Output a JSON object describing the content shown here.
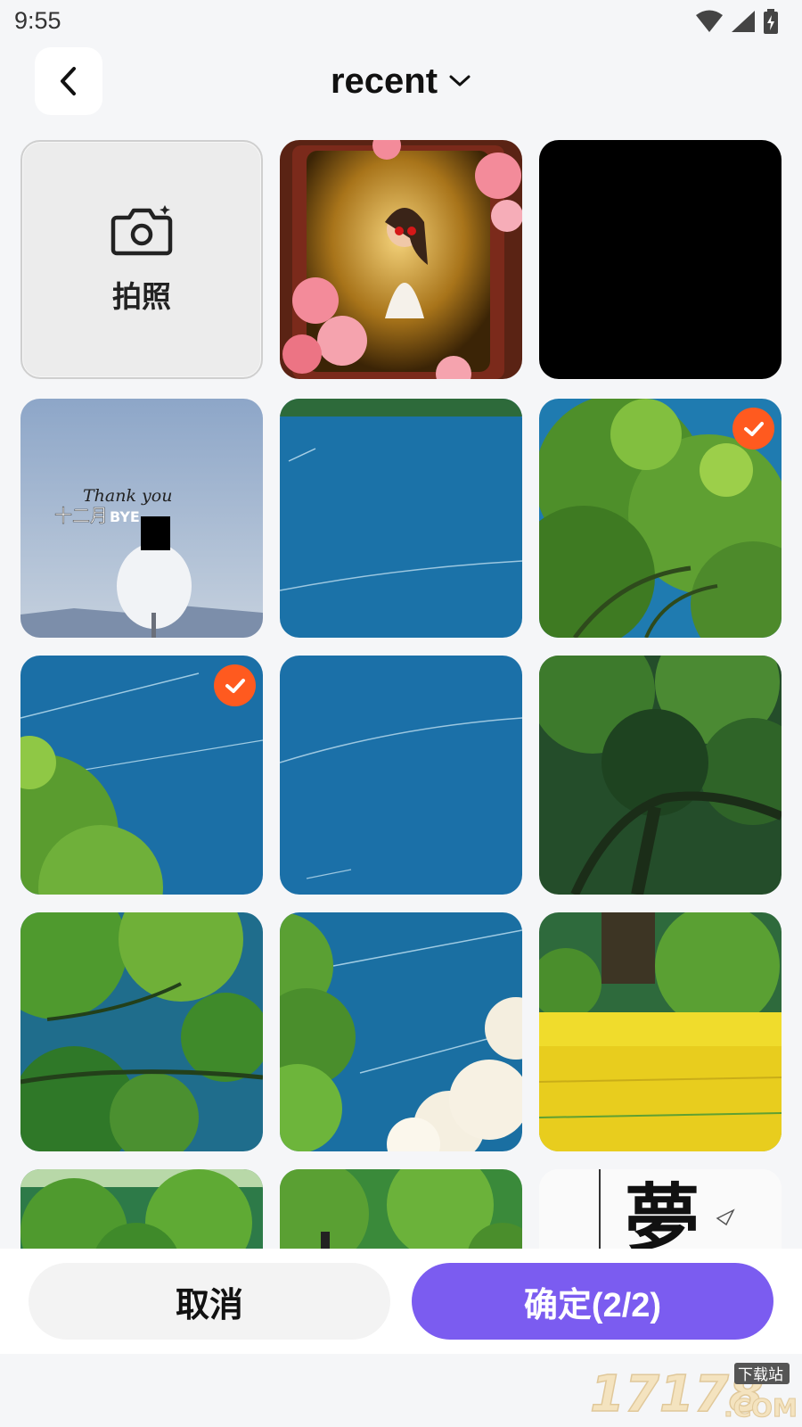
{
  "status_bar": {
    "time": "9:55",
    "icons": [
      "wifi-icon",
      "signal-icon",
      "battery-charging-icon"
    ]
  },
  "header": {
    "back_icon": "chevron-left-icon",
    "title": "recent",
    "dropdown_icon": "chevron-down-icon"
  },
  "grid": {
    "camera_tile": {
      "icon": "camera-icon",
      "label": "拍照"
    },
    "photos": [
      {
        "name": "photo-portrait-frame",
        "selected": false
      },
      {
        "name": "photo-black",
        "selected": false
      },
      {
        "name": "photo-thank-you-text",
        "selected": false,
        "text_lines": [
          "Thank you",
          "十二月",
          "BYE"
        ]
      },
      {
        "name": "photo-blue-sky",
        "selected": false
      },
      {
        "name": "photo-tree-top",
        "selected": true
      },
      {
        "name": "photo-sky-tree-corner",
        "selected": true
      },
      {
        "name": "photo-blue-sky-2",
        "selected": false
      },
      {
        "name": "photo-dark-tree",
        "selected": false
      },
      {
        "name": "photo-tree-branches",
        "selected": false
      },
      {
        "name": "photo-sky-clouds",
        "selected": false
      },
      {
        "name": "photo-yellow-field",
        "selected": false
      },
      {
        "name": "photo-green-hills",
        "selected": false
      },
      {
        "name": "photo-green-figure",
        "selected": false
      },
      {
        "name": "photo-calligraphy",
        "selected": false,
        "text": "夢"
      }
    ]
  },
  "footer": {
    "cancel_label": "取消",
    "confirm_label": "确定(2/2)",
    "selected_count": 2,
    "max_count": 2
  },
  "watermark": {
    "text": "17178",
    "sub": "下载站",
    "suffix": ".COM"
  },
  "colors": {
    "accent": "#7b5cf0",
    "check": "#ff5a1f",
    "background": "#f5f6f8"
  }
}
